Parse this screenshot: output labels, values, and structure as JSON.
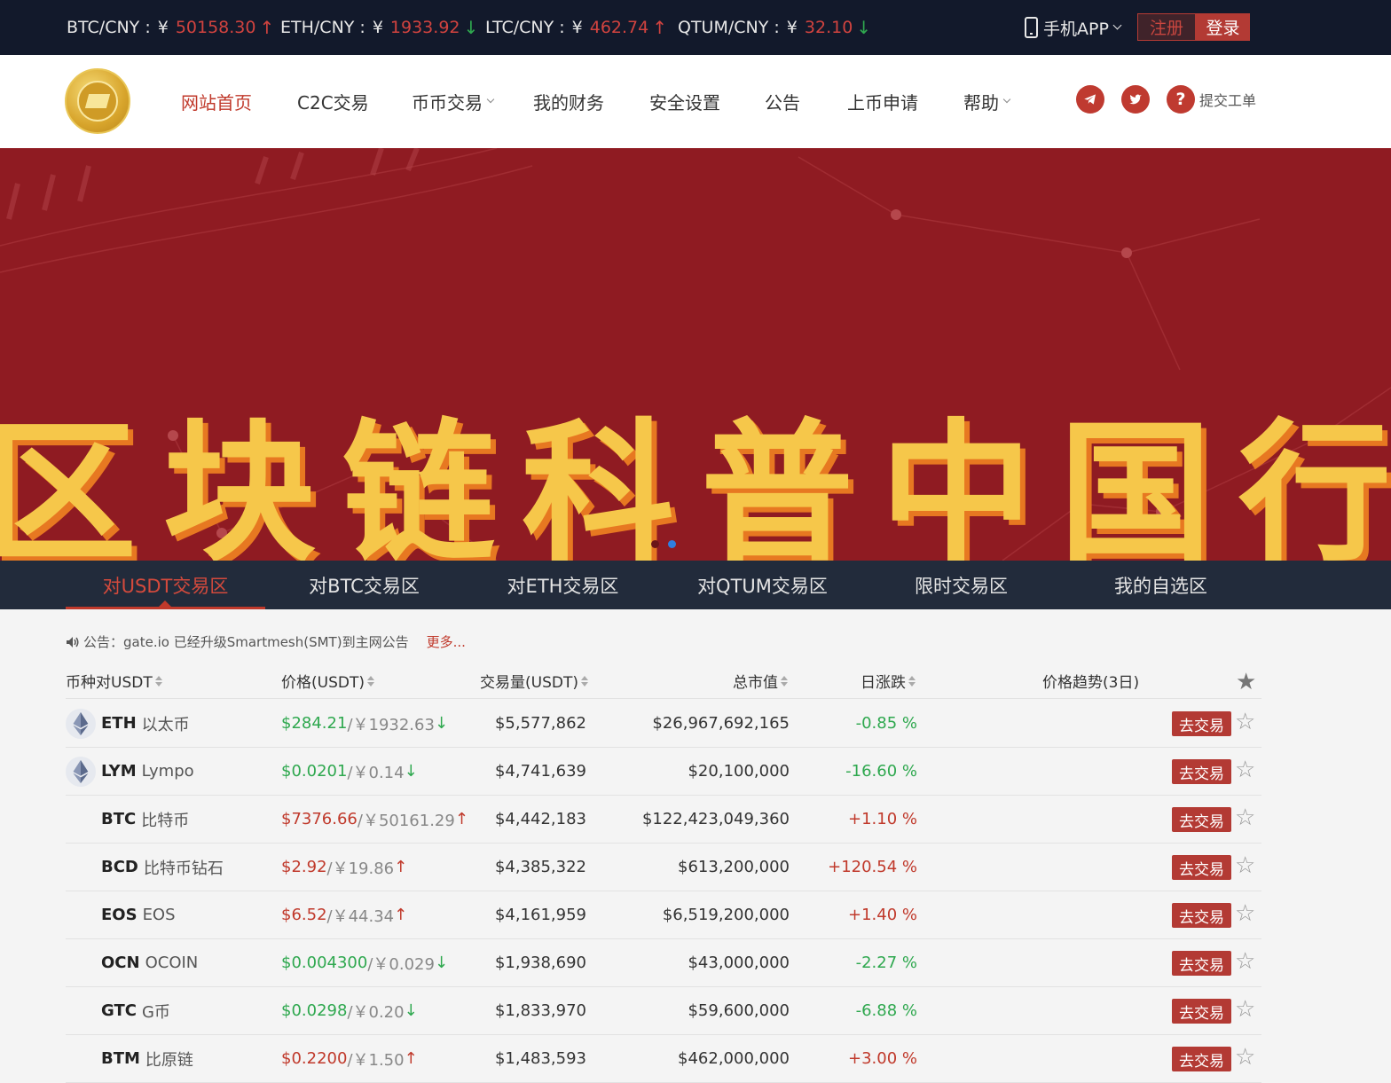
{
  "ticker": [
    {
      "pair": "BTC/CNY :",
      "currency": "¥",
      "price": "50158.30",
      "dir": "up"
    },
    {
      "pair": "ETH/CNY :",
      "currency": "¥",
      "price": "1933.92",
      "dir": "down"
    },
    {
      "pair": "LTC/CNY :",
      "currency": "¥",
      "price": "462.74",
      "dir": "up"
    },
    {
      "pair": "QTUM/CNY :",
      "currency": "¥",
      "price": "32.10",
      "dir": "down"
    }
  ],
  "arrows": {
    "up": "↑",
    "down": "↓"
  },
  "topbar": {
    "app_label": "手机APP",
    "register_label": "注册",
    "login_label": "登录"
  },
  "nav": [
    {
      "label": "网站首页",
      "active": true
    },
    {
      "label": "C2C交易"
    },
    {
      "label": "币币交易",
      "dropdown": true
    },
    {
      "label": "我的财务"
    },
    {
      "label": "安全设置"
    },
    {
      "label": "公告"
    },
    {
      "label": "上币申请"
    },
    {
      "label": "帮助",
      "dropdown": true
    }
  ],
  "header": {
    "ticket_label": "提交工单",
    "ticket_icon": "?"
  },
  "banner": {
    "title": "区块链科普中国行",
    "background": "#8f1b22"
  },
  "tabs": [
    {
      "label": "对USDT交易区",
      "active": true
    },
    {
      "label": "对BTC交易区"
    },
    {
      "label": "对ETH交易区"
    },
    {
      "label": "对QTUM交易区"
    },
    {
      "label": "限时交易区"
    },
    {
      "label": "我的自选区"
    }
  ],
  "notice": {
    "text": "公告：gate.io 已经升级Smartmesh(SMT)到主网公告",
    "more": "更多..."
  },
  "table": {
    "headers": {
      "pair": "币种对USDT",
      "price": "价格(USDT)",
      "volume": "交易量(USDT)",
      "market_cap": "总市值",
      "change": "日涨跌",
      "trend": "价格趋势(3日)"
    },
    "trade_label": "去交易",
    "rows": [
      {
        "symbol": "ETH",
        "name": "以太币",
        "icon": "eth-icon",
        "price_usd": "$284.21",
        "price_cny": "/￥1932.63",
        "dir": "down",
        "volume": "$5,577,862",
        "market_cap": "$26,967,692,165",
        "change": "-0.85 %"
      },
      {
        "symbol": "LYM",
        "name": "Lympo",
        "icon": "eth-icon",
        "price_usd": "$0.0201",
        "price_cny": "/￥0.14",
        "dir": "down",
        "volume": "$4,741,639",
        "market_cap": "$20,100,000",
        "change": "-16.60 %"
      },
      {
        "symbol": "BTC",
        "name": "比特币",
        "icon": "",
        "price_usd": "$7376.66",
        "price_cny": "/￥50161.29",
        "dir": "up",
        "volume": "$4,442,183",
        "market_cap": "$122,423,049,360",
        "change": "+1.10 %"
      },
      {
        "symbol": "BCD",
        "name": "比特币钻石",
        "icon": "",
        "price_usd": "$2.92",
        "price_cny": "/￥19.86",
        "dir": "up",
        "volume": "$4,385,322",
        "market_cap": "$613,200,000",
        "change": "+120.54 %"
      },
      {
        "symbol": "EOS",
        "name": "EOS",
        "icon": "",
        "price_usd": "$6.52",
        "price_cny": "/￥44.34",
        "dir": "up",
        "volume": "$4,161,959",
        "market_cap": "$6,519,200,000",
        "change": "+1.40 %"
      },
      {
        "symbol": "OCN",
        "name": "OCOIN",
        "icon": "",
        "price_usd": "$0.004300",
        "price_cny": "/￥0.029",
        "dir": "down",
        "volume": "$1,938,690",
        "market_cap": "$43,000,000",
        "change": "-2.27 %"
      },
      {
        "symbol": "GTC",
        "name": "G币",
        "icon": "",
        "price_usd": "$0.0298",
        "price_cny": "/￥0.20",
        "dir": "down",
        "volume": "$1,833,970",
        "market_cap": "$59,600,000",
        "change": "-6.88 %"
      },
      {
        "symbol": "BTM",
        "name": "比原链",
        "icon": "",
        "price_usd": "$0.2200",
        "price_cny": "/￥1.50",
        "dir": "up",
        "volume": "$1,483,593",
        "market_cap": "$462,000,000",
        "change": "+3.00 %"
      }
    ]
  },
  "colors": {
    "accent": "#c0392b",
    "up": "#c0392b",
    "down": "#2fa84f",
    "topbar": "#12192b",
    "tabs": "#222b3b"
  }
}
